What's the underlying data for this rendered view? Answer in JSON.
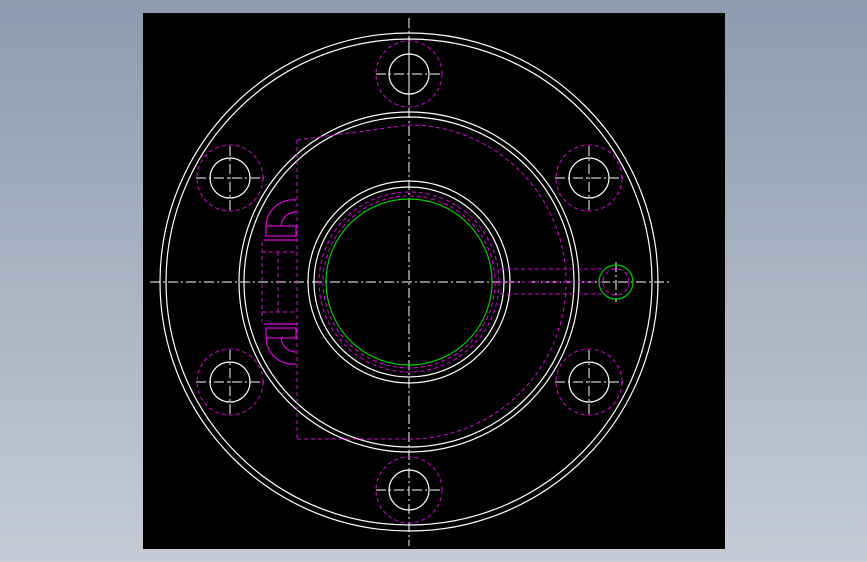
{
  "viewport": {
    "background_top": "#8e9bae",
    "background_bottom": "#c6cbd6"
  },
  "drawing": {
    "background": "#000000",
    "colors": {
      "outline": "#ffffff",
      "hidden": "#e000e0",
      "center": "#ffffff",
      "bore": "#00cc00"
    },
    "views": [
      "top-view"
    ],
    "bolt_hole_count": 6
  }
}
